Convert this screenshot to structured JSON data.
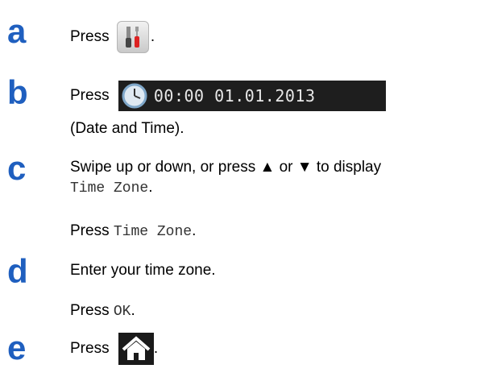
{
  "steps": [
    {
      "letter": "a",
      "press": "Press",
      "period": "."
    },
    {
      "letter": "b",
      "press": "Press",
      "datetime": "00:00 01.01.2013",
      "caption": "(Date and Time)."
    },
    {
      "letter": "c",
      "line1": "Swipe up or down, or press ▲ or ▼ to display",
      "line2_code": "Time Zone",
      "period": ".",
      "line3_press": "Press",
      "line3_code": "Time Zone"
    },
    {
      "letter": "d",
      "line1": "Enter your time zone.",
      "line2_press": "Press",
      "line2_code": "OK"
    },
    {
      "letter": "e",
      "press": "Press",
      "period": "."
    }
  ],
  "icons": {
    "tools": "settings-tools-icon",
    "clock": "clock-icon",
    "home": "home-icon"
  },
  "colors": {
    "step_letter": "#1f5fbf",
    "button_dark": "#1e1e1e"
  }
}
